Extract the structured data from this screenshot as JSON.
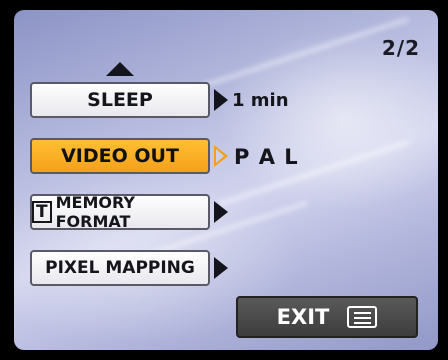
{
  "page_indicator": "2/2",
  "menu": [
    {
      "label": "SLEEP",
      "value": "1 min"
    },
    {
      "label": "VIDEO OUT",
      "value": "P A L"
    },
    {
      "label": "MEMORY FORMAT",
      "value": ""
    },
    {
      "label": "PIXEL MAPPING",
      "value": ""
    }
  ],
  "exit_label": "EXIT",
  "icons": [
    "up-arrow-icon",
    "right-arrow-icon",
    "memory-card-icon",
    "menu-list-icon"
  ],
  "colors": {
    "selected": "#f4a01a",
    "background": "#b9bde0",
    "exit_button": "#4a4a4a"
  }
}
